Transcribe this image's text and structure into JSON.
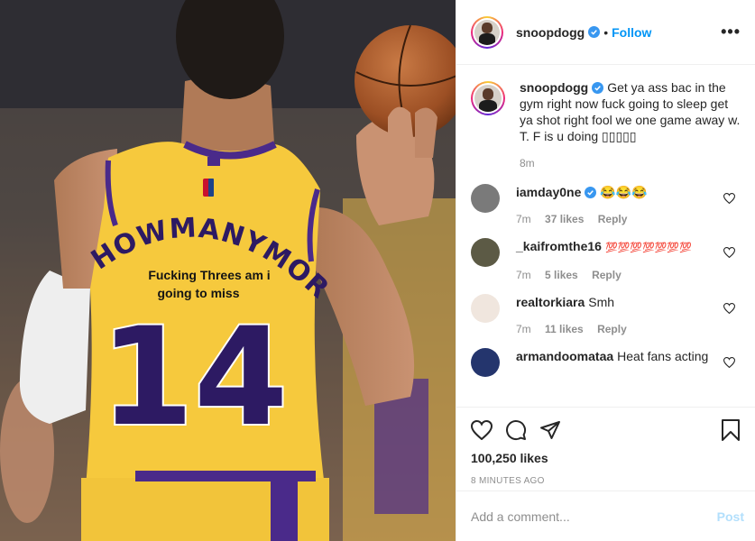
{
  "post": {
    "image": {
      "jersey_top_text": "HOWMANYMORE",
      "jersey_line1": "Fucking Threes am i",
      "jersey_line2": "going to miss",
      "jersey_number": "14"
    },
    "author": {
      "username": "snoopdogg",
      "follow_label": "Follow",
      "more_label": "•••"
    },
    "caption": {
      "username": "snoopdogg",
      "text": "Get ya ass bac in the gym right now fuck going to sleep get ya shot right fool we one game away w. T. F is u doing ▯▯▯▯▯",
      "age": "8m"
    },
    "comments": [
      {
        "username": "iamday0ne",
        "verified": true,
        "text": "😂😂😂",
        "age": "7m",
        "likes": "37 likes",
        "reply": "Reply"
      },
      {
        "username": "_kaifromthe16",
        "verified": false,
        "text": "💯💯💯💯💯💯💯",
        "age": "7m",
        "likes": "5 likes",
        "reply": "Reply"
      },
      {
        "username": "realtorkiara",
        "verified": false,
        "text": "Smh",
        "age": "7m",
        "likes": "11 likes",
        "reply": "Reply"
      },
      {
        "username": "armandoomataa",
        "verified": false,
        "text": "Heat fans acting",
        "age": "",
        "likes": "",
        "reply": ""
      }
    ],
    "likes_count": "100,250 likes",
    "timestamp": "8 MINUTES AGO",
    "add_comment_placeholder": "Add a comment...",
    "post_button": "Post"
  },
  "colors": {
    "accent": "#0095f6",
    "jersey_gold": "#f6c93d",
    "jersey_purple": "#4a2a8a"
  }
}
